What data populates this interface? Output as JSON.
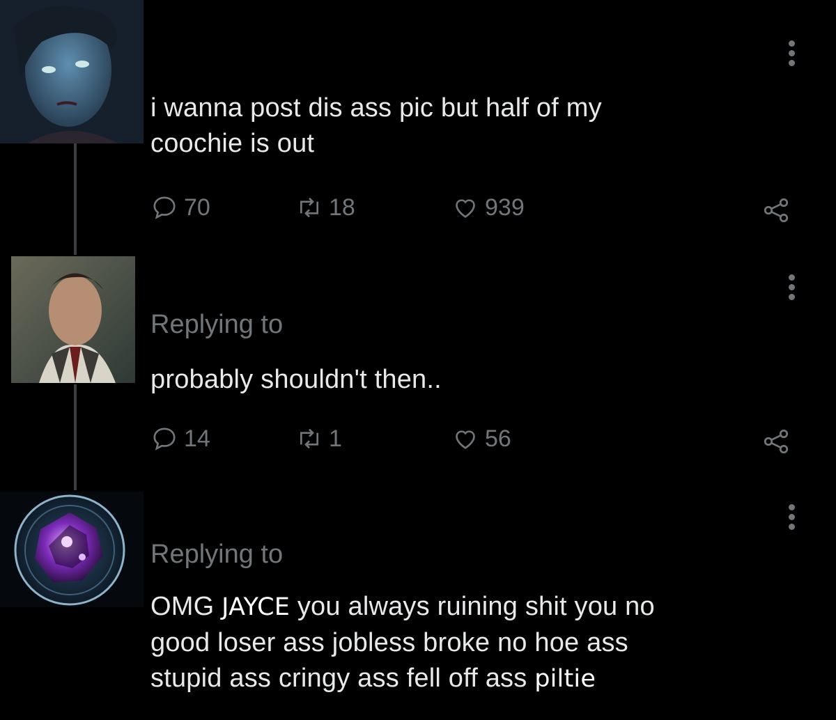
{
  "tweets": [
    {
      "avatar": "character-portrait-avatar",
      "text_line1": "i wanna post dis ass pic but half of my",
      "text_line2": "coochie is out",
      "replies": "70",
      "retweets": "18",
      "likes": "939"
    },
    {
      "avatar": "character-portrait-avatar",
      "replying_label": "Replying to",
      "text": "probably shouldn't then..",
      "replies": "14",
      "retweets": "1",
      "likes": "56"
    },
    {
      "avatar": "hextech-gem-avatar",
      "replying_label": "Replying to",
      "line1_a": "OMG",
      "line1_b": "JAYCE",
      "line1_c": "you always ruining shit you no",
      "line2": "good loser ass jobless broke no hoe ass",
      "line3_a": "stupid ass cringy ass fell off ass",
      "line3_b": "piltie"
    }
  ],
  "icons": {
    "reply": "speech-bubble-icon",
    "retweet": "retweet-arrows-icon",
    "like": "heart-icon",
    "share": "share-nodes-icon",
    "more": "vertical-ellipsis-icon"
  },
  "colors": {
    "background": "#000000",
    "text": "#e7e9ea",
    "muted": "#71767b",
    "thread_line": "#3a3d41"
  }
}
